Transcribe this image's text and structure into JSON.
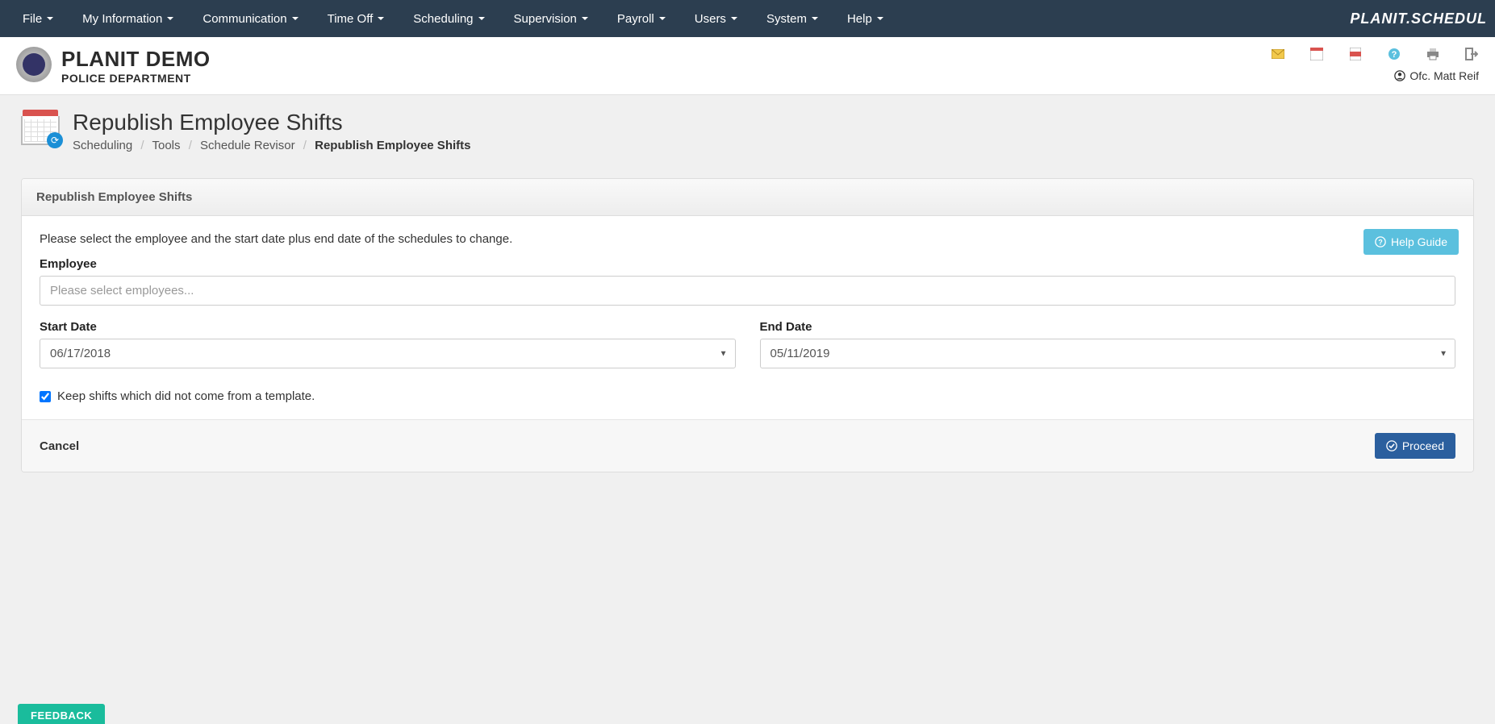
{
  "nav": {
    "items": [
      "File",
      "My Information",
      "Communication",
      "Time Off",
      "Scheduling",
      "Supervision",
      "Payroll",
      "Users",
      "System",
      "Help"
    ],
    "brand": "PLANIT.SCHEDUL"
  },
  "header": {
    "org_name": "PLANIT DEMO",
    "org_sub": "POLICE DEPARTMENT",
    "user_label": "Ofc. Matt Reif"
  },
  "page": {
    "title": "Republish Employee Shifts",
    "breadcrumb": [
      "Scheduling",
      "Tools",
      "Schedule Revisor",
      "Republish Employee Shifts"
    ]
  },
  "panel": {
    "heading": "Republish Employee Shifts",
    "instruction": "Please select the employee and the start date plus end date of the schedules to change.",
    "help_guide": "Help Guide",
    "employee_label": "Employee",
    "employee_placeholder": "Please select employees...",
    "start_date_label": "Start Date",
    "start_date_value": "06/17/2018",
    "end_date_label": "End Date",
    "end_date_value": "05/11/2019",
    "keep_shifts_label": "Keep shifts which did not come from a template.",
    "keep_shifts_checked": true,
    "cancel": "Cancel",
    "proceed": "Proceed"
  },
  "feedback": "FEEDBACK"
}
